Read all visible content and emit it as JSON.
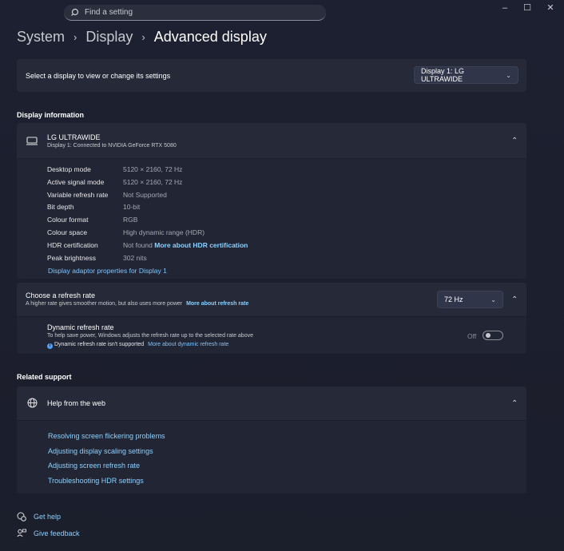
{
  "search": {
    "placeholder": "Find a setting"
  },
  "window": {
    "minimize": "–",
    "maximize": "☐",
    "close": "✕"
  },
  "breadcrumb": {
    "level1": "System",
    "level2": "Display",
    "current": "Advanced display"
  },
  "display_select": {
    "label": "Select a display to view or change its settings",
    "value": "Display 1: LG ULTRAWIDE"
  },
  "display_info": {
    "header": "Display information",
    "monitor_name": "LG ULTRAWIDE",
    "monitor_sub": "Display 1: Connected to NVIDIA GeForce RTX 5080",
    "rows": [
      {
        "label": "Desktop mode",
        "value": "5120 × 2160, 72 Hz"
      },
      {
        "label": "Active signal mode",
        "value": "5120 × 2160, 72 Hz"
      },
      {
        "label": "Variable refresh rate",
        "value": "Not Supported"
      },
      {
        "label": "Bit depth",
        "value": "10-bit"
      },
      {
        "label": "Colour format",
        "value": "RGB"
      },
      {
        "label": "Colour space",
        "value": "High dynamic range (HDR)"
      },
      {
        "label": "HDR certification",
        "value": "Not found",
        "link": "More about HDR certification"
      },
      {
        "label": "Peak brightness",
        "value": "302 nits"
      }
    ],
    "adapter_link": "Display adaptor properties for Display 1"
  },
  "refresh": {
    "title": "Choose a refresh rate",
    "desc": "A higher rate gives smoother motion, but also uses more power",
    "link": "More about refresh rate",
    "value": "72 Hz",
    "dynamic_title": "Dynamic refresh rate",
    "dynamic_desc": "To help save power, Windows adjusts the refresh rate up to the selected rate above",
    "dynamic_note": "Dynamic refresh rate isn't supported",
    "dynamic_link": "More about dynamic refresh rate",
    "toggle_label": "Off",
    "toggle_on": false
  },
  "related": {
    "header": "Related support",
    "help_title": "Help from the web",
    "links": [
      "Resolving screen flickering problems",
      "Adjusting display scaling settings",
      "Adjusting screen refresh rate",
      "Troubleshooting HDR settings"
    ]
  },
  "footer": {
    "get_help": "Get help",
    "give_feedback": "Give feedback"
  },
  "colors": {
    "accent": "#8cd0ff",
    "info": "#4aa3ff"
  }
}
